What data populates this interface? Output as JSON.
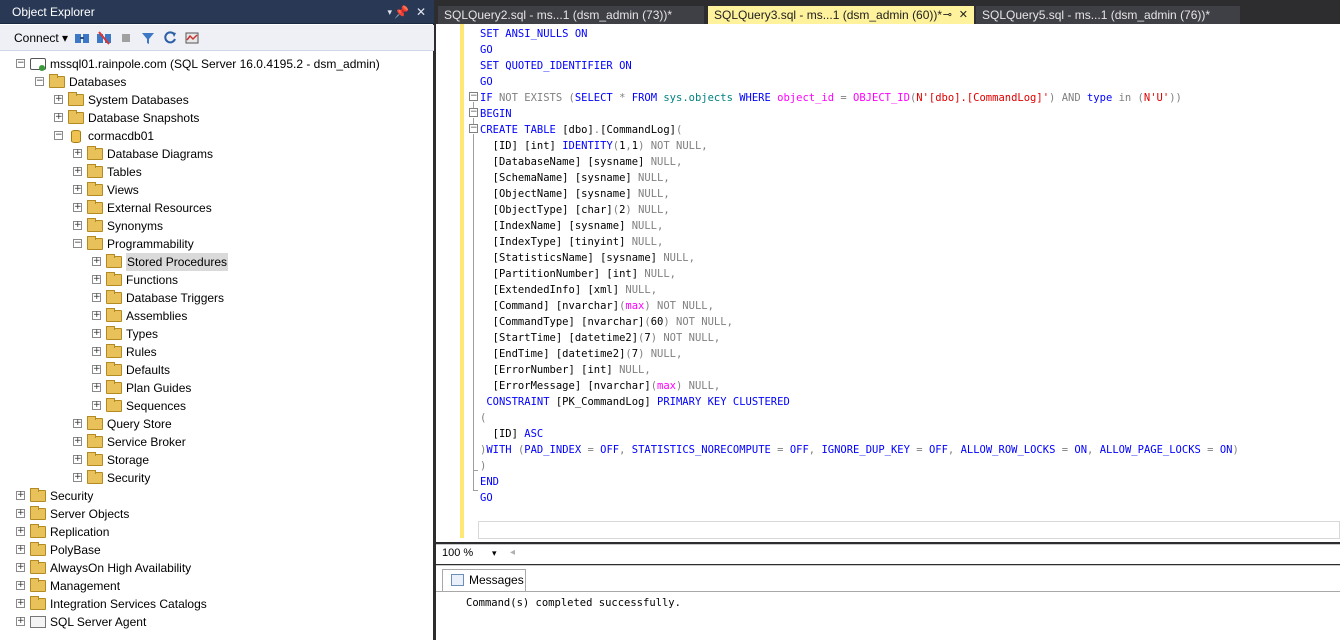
{
  "object_explorer": {
    "title": "Object Explorer",
    "title_controls": {
      "dropdown": "▾",
      "pin": "ᵖ",
      "close": "✕"
    },
    "toolbar": {
      "connect_label": "Connect ▾"
    },
    "tree": [
      {
        "label": "mssql01.rainpole.com (SQL Server 16.0.4195.2 - dsm_admin)",
        "exp": "⊟",
        "icon": "server",
        "indent": 0
      },
      {
        "label": "Databases",
        "exp": "⊟",
        "icon": "folder",
        "indent": 1
      },
      {
        "label": "System Databases",
        "exp": "⊞",
        "icon": "folder",
        "indent": 2
      },
      {
        "label": "Database Snapshots",
        "exp": "⊞",
        "icon": "folder",
        "indent": 2
      },
      {
        "label": "cormacdb01",
        "exp": "⊟",
        "icon": "database",
        "indent": 2
      },
      {
        "label": "Database Diagrams",
        "exp": "⊞",
        "icon": "folder",
        "indent": 3
      },
      {
        "label": "Tables",
        "exp": "⊞",
        "icon": "folder",
        "indent": 3
      },
      {
        "label": "Views",
        "exp": "⊞",
        "icon": "folder",
        "indent": 3
      },
      {
        "label": "External Resources",
        "exp": "⊞",
        "icon": "folder",
        "indent": 3
      },
      {
        "label": "Synonyms",
        "exp": "⊞",
        "icon": "folder",
        "indent": 3
      },
      {
        "label": "Programmability",
        "exp": "⊟",
        "icon": "folder",
        "indent": 3
      },
      {
        "label": "Stored Procedures",
        "exp": "⊞",
        "icon": "folder",
        "indent": 4,
        "selected": true
      },
      {
        "label": "Functions",
        "exp": "⊞",
        "icon": "folder",
        "indent": 4
      },
      {
        "label": "Database Triggers",
        "exp": "⊞",
        "icon": "folder",
        "indent": 4
      },
      {
        "label": "Assemblies",
        "exp": "⊞",
        "icon": "folder",
        "indent": 4
      },
      {
        "label": "Types",
        "exp": "⊞",
        "icon": "folder",
        "indent": 4
      },
      {
        "label": "Rules",
        "exp": "⊞",
        "icon": "folder",
        "indent": 4
      },
      {
        "label": "Defaults",
        "exp": "⊞",
        "icon": "folder",
        "indent": 4
      },
      {
        "label": "Plan Guides",
        "exp": "⊞",
        "icon": "folder",
        "indent": 4
      },
      {
        "label": "Sequences",
        "exp": "⊞",
        "icon": "folder",
        "indent": 4
      },
      {
        "label": "Query Store",
        "exp": "⊞",
        "icon": "folder",
        "indent": 3
      },
      {
        "label": "Service Broker",
        "exp": "⊞",
        "icon": "folder",
        "indent": 3
      },
      {
        "label": "Storage",
        "exp": "⊞",
        "icon": "folder",
        "indent": 3
      },
      {
        "label": "Security",
        "exp": "⊞",
        "icon": "folder",
        "indent": 3
      },
      {
        "label": "Security",
        "exp": "⊞",
        "icon": "folder",
        "indent": 0
      },
      {
        "label": "Server Objects",
        "exp": "⊞",
        "icon": "folder",
        "indent": 0
      },
      {
        "label": "Replication",
        "exp": "⊞",
        "icon": "folder",
        "indent": 0
      },
      {
        "label": "PolyBase",
        "exp": "⊞",
        "icon": "folder",
        "indent": 0
      },
      {
        "label": "AlwaysOn High Availability",
        "exp": "⊞",
        "icon": "folder",
        "indent": 0
      },
      {
        "label": "Management",
        "exp": "⊞",
        "icon": "folder",
        "indent": 0
      },
      {
        "label": "Integration Services Catalogs",
        "exp": "⊞",
        "icon": "folder",
        "indent": 0
      },
      {
        "label": "SQL Server Agent",
        "exp": "⊞",
        "icon": "agent",
        "indent": 0
      }
    ]
  },
  "tabs": [
    {
      "label": "SQLQuery2.sql - ms...1 (dsm_admin (73))*",
      "active": false
    },
    {
      "label": "SQLQuery3.sql - ms...1 (dsm_admin (60))*",
      "active": true,
      "pin": "⊸",
      "close": "✕"
    },
    {
      "label": "SQLQuery5.sql - ms...1 (dsm_admin (76))*",
      "active": false
    }
  ],
  "editor": {
    "lines": [
      [
        [
          "kw",
          "SET ANSI_NULLS ON"
        ]
      ],
      [
        [
          "kw",
          "GO"
        ]
      ],
      [
        [
          "kw",
          "SET QUOTED_IDENTIFIER ON"
        ]
      ],
      [
        [
          "kw",
          "GO"
        ]
      ],
      [
        [
          "kw",
          "IF "
        ],
        [
          "gr",
          "NOT EXISTS ("
        ],
        [
          "kw",
          "SELECT "
        ],
        [
          "gr",
          "* "
        ],
        [
          "kw",
          "FROM "
        ],
        [
          "gn",
          "sys.objects "
        ],
        [
          "kw",
          "WHERE "
        ],
        [
          "fn",
          "object_id "
        ],
        [
          "gr",
          "= "
        ],
        [
          "fn",
          "OBJECT_ID"
        ],
        [
          "gr",
          "("
        ],
        [
          "st",
          "N'[dbo].[CommandLog]'"
        ],
        [
          "gr",
          ") "
        ],
        [
          "gr",
          "AND "
        ],
        [
          "kw",
          "type "
        ],
        [
          "gr",
          "in ("
        ],
        [
          "st",
          "N'U'"
        ],
        [
          "gr",
          "))"
        ]
      ],
      [
        [
          "kw",
          "BEGIN"
        ]
      ],
      [
        [
          "kw",
          "CREATE TABLE "
        ],
        [
          "",
          "[dbo]"
        ],
        [
          "gr",
          "."
        ],
        [
          "",
          "[CommandLog]"
        ],
        [
          "gr",
          "("
        ]
      ],
      [
        [
          "",
          "  [ID] [int] "
        ],
        [
          "kw",
          "IDENTITY"
        ],
        [
          "gr",
          "("
        ],
        [
          "",
          "1"
        ],
        [
          "gr",
          ","
        ],
        [
          "",
          "1"
        ],
        [
          "gr",
          ") NOT NULL,"
        ]
      ],
      [
        [
          "",
          "  [DatabaseName] [sysname] "
        ],
        [
          "gr",
          "NULL,"
        ]
      ],
      [
        [
          "",
          "  [SchemaName] [sysname] "
        ],
        [
          "gr",
          "NULL,"
        ]
      ],
      [
        [
          "",
          "  [ObjectName] [sysname] "
        ],
        [
          "gr",
          "NULL,"
        ]
      ],
      [
        [
          "",
          "  [ObjectType] [char]"
        ],
        [
          "gr",
          "("
        ],
        [
          "",
          "2"
        ],
        [
          "gr",
          ") NULL,"
        ]
      ],
      [
        [
          "",
          "  [IndexName] [sysname] "
        ],
        [
          "gr",
          "NULL,"
        ]
      ],
      [
        [
          "",
          "  [IndexType] [tinyint] "
        ],
        [
          "gr",
          "NULL,"
        ]
      ],
      [
        [
          "",
          "  [StatisticsName] [sysname] "
        ],
        [
          "gr",
          "NULL,"
        ]
      ],
      [
        [
          "",
          "  [PartitionNumber] [int] "
        ],
        [
          "gr",
          "NULL,"
        ]
      ],
      [
        [
          "",
          "  [ExtendedInfo] [xml] "
        ],
        [
          "gr",
          "NULL,"
        ]
      ],
      [
        [
          "",
          "  [Command] [nvarchar]"
        ],
        [
          "gr",
          "("
        ],
        [
          "fn",
          "max"
        ],
        [
          "gr",
          ") NOT NULL,"
        ]
      ],
      [
        [
          "",
          "  [CommandType] [nvarchar]"
        ],
        [
          "gr",
          "("
        ],
        [
          "",
          "60"
        ],
        [
          "gr",
          ") NOT NULL,"
        ]
      ],
      [
        [
          "",
          "  [StartTime] [datetime2]"
        ],
        [
          "gr",
          "("
        ],
        [
          "",
          "7"
        ],
        [
          "gr",
          ") NOT NULL,"
        ]
      ],
      [
        [
          "",
          "  [EndTime] [datetime2]"
        ],
        [
          "gr",
          "("
        ],
        [
          "",
          "7"
        ],
        [
          "gr",
          ") NULL,"
        ]
      ],
      [
        [
          "",
          "  [ErrorNumber] [int] "
        ],
        [
          "gr",
          "NULL,"
        ]
      ],
      [
        [
          "",
          "  [ErrorMessage] [nvarchar]"
        ],
        [
          "gr",
          "("
        ],
        [
          "fn",
          "max"
        ],
        [
          "gr",
          ") NULL,"
        ]
      ],
      [
        [
          "kw",
          " CONSTRAINT "
        ],
        [
          "",
          "[PK_CommandLog] "
        ],
        [
          "kw",
          "PRIMARY KEY CLUSTERED"
        ]
      ],
      [
        [
          "gr",
          "("
        ]
      ],
      [
        [
          "",
          "  [ID] "
        ],
        [
          "kw",
          "ASC"
        ]
      ],
      [
        [
          "gr",
          ")"
        ],
        [
          "kw",
          "WITH "
        ],
        [
          "gr",
          "("
        ],
        [
          "kw",
          "PAD_INDEX "
        ],
        [
          "gr",
          "= "
        ],
        [
          "kw",
          "OFF"
        ],
        [
          "gr",
          ", "
        ],
        [
          "kw",
          "STATISTICS_NORECOMPUTE "
        ],
        [
          "gr",
          "= "
        ],
        [
          "kw",
          "OFF"
        ],
        [
          "gr",
          ", "
        ],
        [
          "kw",
          "IGNORE_DUP_KEY "
        ],
        [
          "gr",
          "= "
        ],
        [
          "kw",
          "OFF"
        ],
        [
          "gr",
          ", "
        ],
        [
          "kw",
          "ALLOW_ROW_LOCKS "
        ],
        [
          "gr",
          "= "
        ],
        [
          "kw",
          "ON"
        ],
        [
          "gr",
          ", "
        ],
        [
          "kw",
          "ALLOW_PAGE_LOCKS "
        ],
        [
          "gr",
          "= "
        ],
        [
          "kw",
          "ON"
        ],
        [
          "gr",
          ")"
        ]
      ],
      [
        [
          "gr",
          ")"
        ]
      ],
      [
        [
          "kw",
          "END"
        ]
      ],
      [
        [
          "kw",
          "GO"
        ]
      ]
    ]
  },
  "zoom": {
    "level": "100 %",
    "arrow": "▾",
    "scroll_left": "◂"
  },
  "results": {
    "tab_label": "Messages",
    "message": "Command(s) completed successfully."
  }
}
